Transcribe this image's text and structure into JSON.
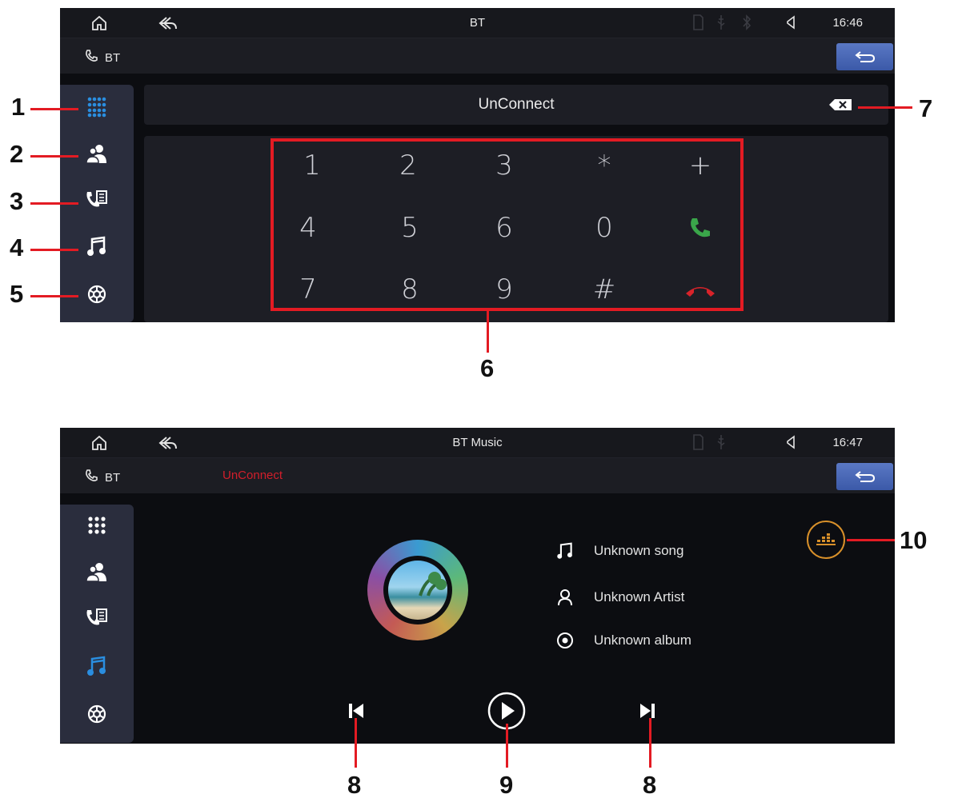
{
  "screen1": {
    "status_bar": {
      "title": "BT",
      "time": "16:46"
    },
    "sub_bar": {
      "label": "BT"
    },
    "sidebar_items": [
      "dialpad-icon",
      "contacts-icon",
      "call-log-icon",
      "music-icon",
      "settings-icon"
    ],
    "number_bar": {
      "status": "UnConnect"
    },
    "keypad": {
      "keys": [
        "1",
        "2",
        "3",
        "*",
        "+",
        "4",
        "5",
        "6",
        "0",
        "7",
        "8",
        "9",
        "#"
      ],
      "call_color": "#3aa64a",
      "hangup_color": "#d8232a"
    }
  },
  "screen2": {
    "status_bar": {
      "title": "BT Music",
      "time": "16:47"
    },
    "sub_bar": {
      "label": "BT",
      "connection_status": "UnConnect"
    },
    "sidebar_items": [
      "dialpad-icon",
      "contacts-icon",
      "call-log-icon",
      "music-icon",
      "settings-icon"
    ],
    "track": {
      "song": "Unknown song",
      "artist": "Unknown Artist",
      "album": "Unknown album"
    },
    "eq_color": "#d8902a"
  },
  "callouts": {
    "c1": "1",
    "c2": "2",
    "c3": "3",
    "c4": "4",
    "c5": "5",
    "c6": "6",
    "c7": "7",
    "c8a": "8",
    "c9": "9",
    "c8b": "8",
    "c10": "10"
  },
  "colors": {
    "accent_active": "#2a8ee0",
    "callout_red": "#e31b23",
    "unconnect_red": "#d21e2b"
  }
}
